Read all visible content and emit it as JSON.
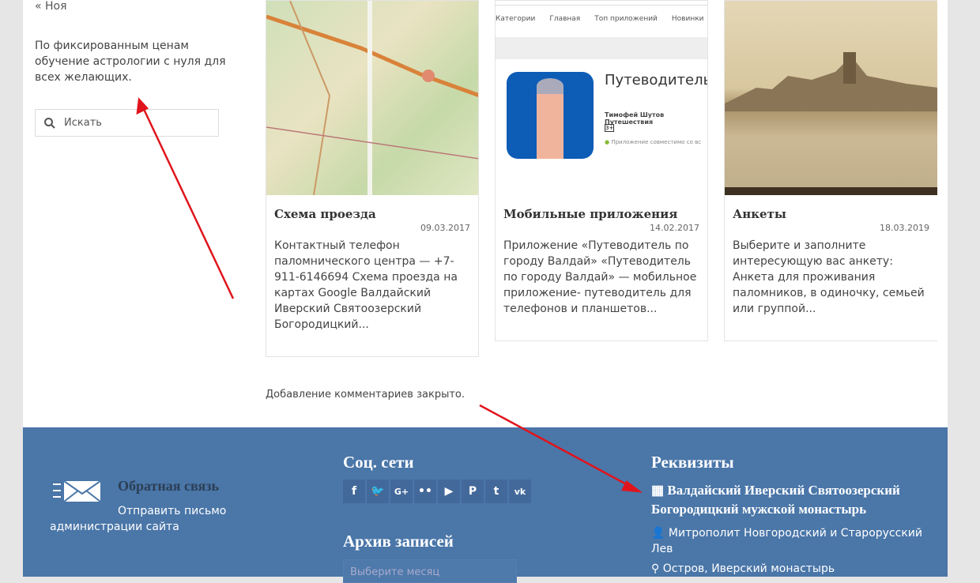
{
  "sidebar": {
    "prev_link": "« Ноя",
    "description": "По фиксированным ценам обучение астрологии с нуля для всех желающих.",
    "search_placeholder": "Искать"
  },
  "cards": [
    {
      "title": "Схема проезда",
      "date": "09.03.2017",
      "excerpt": "Контактный телефон паломнического центра — +7-911-6146694 Схема проезда на картах Google Валдайский Иверский Святоозерский Богородицкий..."
    },
    {
      "title": "Мобильные приложения",
      "date": "14.02.2017",
      "excerpt": "Приложение «Путеводитель по городу Валдай» «Путеводитель по городу Валдай» — мобильное приложение- путеводитель для телефонов и планшетов...",
      "shot": {
        "nav": [
          "Категории",
          "Главная",
          "Топ приложений",
          "Новинки"
        ],
        "app_title": "Путеводитель по Валдай",
        "author": "Тимофей Шутов",
        "category": "Путешествия",
        "age": "3+",
        "compat": "Приложение совместимо со вс"
      }
    },
    {
      "title": "Анкеты",
      "date": "18.03.2019",
      "excerpt": "Выберите и заполните интересующую вас анкету: Анкета для проживания паломников, в одиночку, семьей или группой..."
    }
  ],
  "comments_closed": "Добавление комментариев закрыто.",
  "footer": {
    "feedback": {
      "title": "Обратная связь",
      "text": "Отправить письмо администрации сайта"
    },
    "social": {
      "title": "Соц. сети",
      "icons": [
        "f",
        "🐦",
        "G+",
        "••",
        "▶",
        "P",
        "t",
        "vk"
      ]
    },
    "archive": {
      "title": "Архив записей",
      "placeholder": "Выберите месяц"
    },
    "requisites": {
      "title": "Реквизиты",
      "org": "Валдайский Иверский Святоозерский Богородицкий мужской монастырь",
      "head": "Митрополит Новгородский и Старорусский Лев",
      "address": "Остров, Иверский монастырь"
    }
  },
  "colors": {
    "footer": "#4a76a8",
    "arrow": "#e0141c"
  }
}
